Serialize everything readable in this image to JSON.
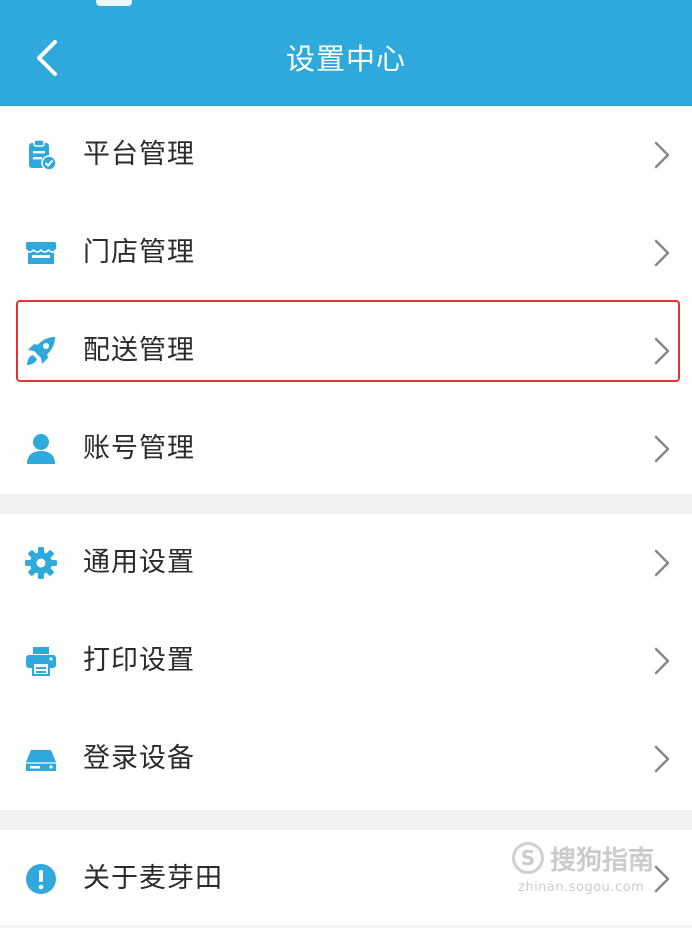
{
  "header": {
    "title": "设置中心",
    "back_icon": "chevron-left-icon",
    "background": "#2fa9dc"
  },
  "colors": {
    "accent": "#2fa9dc",
    "highlight_border": "#e5322d",
    "label_text": "#2b2b2b",
    "chevron": "#888888"
  },
  "groups": [
    {
      "items": [
        {
          "label": "平台管理",
          "icon": "clipboard-check-icon"
        },
        {
          "label": "门店管理",
          "icon": "storefront-icon"
        },
        {
          "label": "配送管理",
          "icon": "rocket-icon",
          "highlighted": true
        },
        {
          "label": "账号管理",
          "icon": "user-icon"
        }
      ]
    },
    {
      "items": [
        {
          "label": "通用设置",
          "icon": "gear-icon"
        },
        {
          "label": "打印设置",
          "icon": "printer-icon"
        },
        {
          "label": "登录设备",
          "icon": "device-icon"
        }
      ]
    },
    {
      "items": [
        {
          "label": "关于麦芽田",
          "icon": "info-icon"
        }
      ]
    }
  ],
  "watermark": {
    "logo": "S",
    "text": "搜狗指南",
    "url": "zhinan.sogou.com"
  }
}
